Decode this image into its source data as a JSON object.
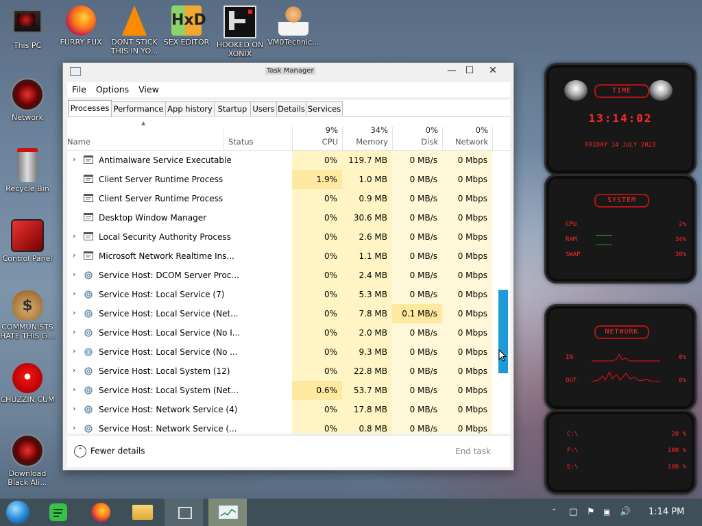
{
  "desktop": {
    "icons": [
      {
        "label": "This PC",
        "icon": "monitor-icon"
      },
      {
        "label": "FURRY FUX",
        "icon": "firefox-icon"
      },
      {
        "label": "DONT STICK THIS IN YO...",
        "icon": "vlc-cone-icon"
      },
      {
        "label": "SEX EDITOR",
        "icon": "hxd-editor-icon"
      },
      {
        "label": "HOOKED ON XONIX",
        "icon": "xonix-game-icon"
      },
      {
        "label": "VM0Technic...",
        "icon": "doctor-icon"
      },
      {
        "label": "Network",
        "icon": "network-orb-icon"
      },
      {
        "label": "Recycle Bin",
        "icon": "recycle-bin-icon"
      },
      {
        "label": "Control Panel",
        "icon": "control-panel-icon"
      },
      {
        "label": "COMMUNISTS HATE THIS G...",
        "icon": "money-bag-icon"
      },
      {
        "label": "CHUZZIN CUM",
        "icon": "chuzzle-icon"
      },
      {
        "label": "Download Black Ali...",
        "icon": "download-orb-icon"
      }
    ]
  },
  "window": {
    "title": "Task Manager",
    "minimize": "—",
    "maximize": "☐",
    "close": "✕",
    "menu": [
      "File",
      "Options",
      "View"
    ],
    "tabs": [
      "Processes",
      "Performance",
      "App history",
      "Startup",
      "Users",
      "Details",
      "Services"
    ],
    "header": {
      "name": "Name",
      "status": "Status",
      "cpu_pct": "9%",
      "cpu": "CPU",
      "mem_pct": "34%",
      "mem": "Memory",
      "disk_pct": "0%",
      "disk": "Disk",
      "net_pct": "0%",
      "net": "Network",
      "sort_arrow": "▲"
    },
    "rows": [
      {
        "expand": "›",
        "icon": "window-process-icon",
        "name": "Antimalware Service Executable",
        "cpu": "0%",
        "mem": "119.7 MB",
        "disk": "0 MB/s",
        "net": "0 Mbps"
      },
      {
        "expand": "",
        "icon": "window-process-icon",
        "name": "Client Server Runtime Process",
        "cpu": "1.9%",
        "mem": "1.0 MB",
        "disk": "0 MB/s",
        "net": "0 Mbps"
      },
      {
        "expand": "",
        "icon": "window-process-icon",
        "name": "Client Server Runtime Process",
        "cpu": "0%",
        "mem": "0.9 MB",
        "disk": "0 MB/s",
        "net": "0 Mbps"
      },
      {
        "expand": "",
        "icon": "window-process-icon",
        "name": "Desktop Window Manager",
        "cpu": "0%",
        "mem": "30.6 MB",
        "disk": "0 MB/s",
        "net": "0 Mbps"
      },
      {
        "expand": "›",
        "icon": "window-process-icon",
        "name": "Local Security Authority Process",
        "cpu": "0%",
        "mem": "2.6 MB",
        "disk": "0 MB/s",
        "net": "0 Mbps"
      },
      {
        "expand": "›",
        "icon": "window-process-icon",
        "name": "Microsoft Network Realtime Ins...",
        "cpu": "0%",
        "mem": "1.1 MB",
        "disk": "0 MB/s",
        "net": "0 Mbps"
      },
      {
        "expand": "›",
        "icon": "gear-icon",
        "name": "Service Host: DCOM Server Proc...",
        "cpu": "0%",
        "mem": "2.4 MB",
        "disk": "0 MB/s",
        "net": "0 Mbps"
      },
      {
        "expand": "›",
        "icon": "gear-icon",
        "name": "Service Host: Local Service (7)",
        "cpu": "0%",
        "mem": "5.3 MB",
        "disk": "0 MB/s",
        "net": "0 Mbps"
      },
      {
        "expand": "›",
        "icon": "gear-icon",
        "name": "Service Host: Local Service (Net...",
        "cpu": "0%",
        "mem": "7.8 MB",
        "disk": "0.1 MB/s",
        "net": "0 Mbps"
      },
      {
        "expand": "›",
        "icon": "gear-icon",
        "name": "Service Host: Local Service (No I...",
        "cpu": "0%",
        "mem": "2.0 MB",
        "disk": "0 MB/s",
        "net": "0 Mbps"
      },
      {
        "expand": "›",
        "icon": "gear-icon",
        "name": "Service Host: Local Service (No ...",
        "cpu": "0%",
        "mem": "9.3 MB",
        "disk": "0 MB/s",
        "net": "0 Mbps"
      },
      {
        "expand": "›",
        "icon": "gear-icon",
        "name": "Service Host: Local System (12)",
        "cpu": "0%",
        "mem": "22.8 MB",
        "disk": "0 MB/s",
        "net": "0 Mbps"
      },
      {
        "expand": "›",
        "icon": "gear-icon",
        "name": "Service Host: Local System (Net...",
        "cpu": "0.6%",
        "mem": "53.7 MB",
        "disk": "0 MB/s",
        "net": "0 Mbps"
      },
      {
        "expand": "›",
        "icon": "gear-icon",
        "name": "Service Host: Network Service (4)",
        "cpu": "0%",
        "mem": "17.8 MB",
        "disk": "0 MB/s",
        "net": "0 Mbps"
      },
      {
        "expand": "›",
        "icon": "gear-icon",
        "name": "Service Host: Network Service (...",
        "cpu": "0%",
        "mem": "0.8 MB",
        "disk": "0 MB/s",
        "net": "0 Mbps"
      }
    ],
    "footer": {
      "fewer_details": "Fewer details",
      "end_task": "End task"
    }
  },
  "widgets": {
    "time": {
      "title": "TIME",
      "clock": "13:14:02",
      "date": "FRIDAY 14 JULY 2023"
    },
    "system": {
      "title": "SYSTEM",
      "cpu_label": "CPU",
      "cpu_value": "2%",
      "ram_label": "RAM",
      "ram_value": "34%",
      "swap_label": "SWAP",
      "swap_value": "30%"
    },
    "network": {
      "title": "NETWORK",
      "in_label": "IN",
      "in_value": "0%",
      "out_label": "OUT",
      "out_value": "0%"
    },
    "drives": [
      {
        "label": "C:\\",
        "value": "28 %"
      },
      {
        "label": "F:\\",
        "value": "100 %"
      },
      {
        "label": "E:\\",
        "value": "100 %"
      }
    ]
  },
  "taskbar": {
    "icons": [
      "start-orb-icon",
      "notes-app-icon",
      "firefox-icon",
      "file-explorer-icon",
      "task-view-icon",
      "task-manager-icon"
    ],
    "clock": "1:14 PM"
  }
}
